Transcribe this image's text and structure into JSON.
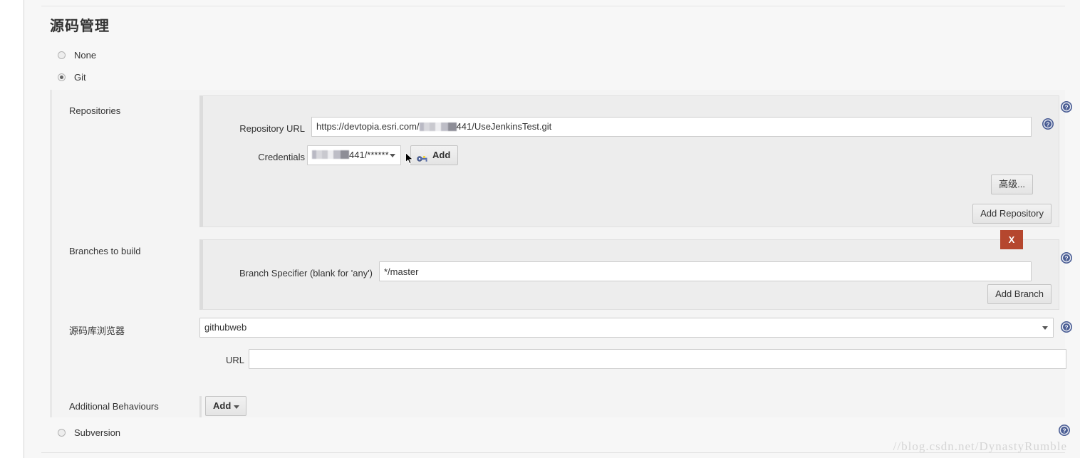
{
  "section": {
    "title": "源码管理"
  },
  "scm_options": [
    {
      "label": "None",
      "checked": false
    },
    {
      "label": "Git",
      "checked": true
    },
    {
      "label": "Subversion",
      "checked": false
    }
  ],
  "repositories": {
    "label": "Repositories",
    "repository_url": {
      "label": "Repository URL",
      "value_prefix": "https://devtopia.esri.com/",
      "value_suffix": "441/UseJenkinsTest.git",
      "redacted": true
    },
    "credentials": {
      "label": "Credentials",
      "selected_suffix": "441/******",
      "redacted": true,
      "add_button": "Add",
      "add_icon": "key-icon"
    },
    "advanced_button": "高级...",
    "add_repository_button": "Add Repository"
  },
  "branches": {
    "label": "Branches to build",
    "branch_specifier": {
      "label": "Branch Specifier (blank for 'any')",
      "value": "*/master"
    },
    "delete_button": "X",
    "add_branch_button": "Add Branch"
  },
  "repository_browser": {
    "label": "源码库浏览器",
    "selected": "githubweb",
    "url": {
      "label": "URL",
      "value": "",
      "placeholder": ""
    }
  },
  "additional_behaviours": {
    "label": "Additional Behaviours",
    "add_button": "Add"
  },
  "help_icon_name": "help-icon",
  "watermark": "//blog.csdn.net/DynastyRumble",
  "colors": {
    "panel_bg": "#f7f7f7",
    "nested_bg": "#ededed",
    "delete_red": "#b5472e",
    "help_blue": "#4a5d94",
    "text": "#333333"
  }
}
